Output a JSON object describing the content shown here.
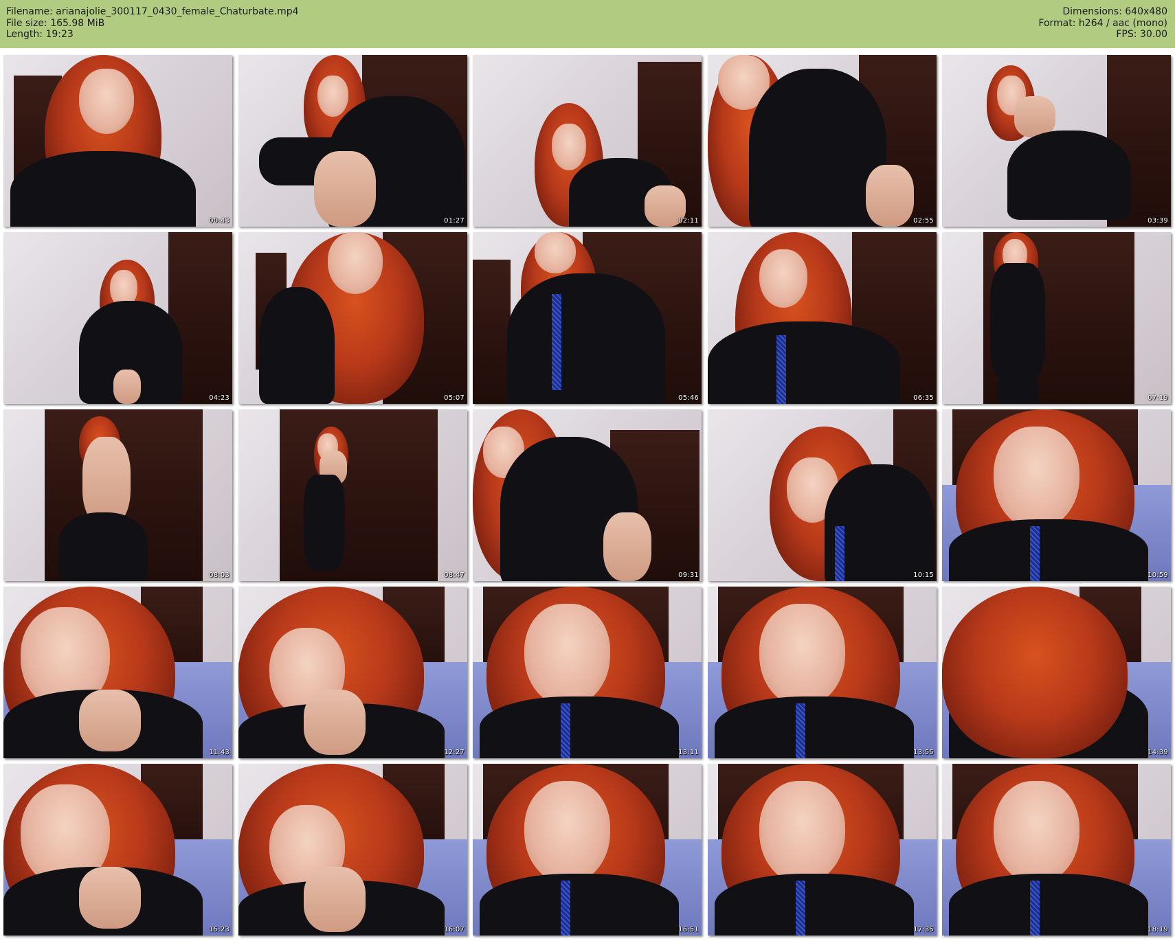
{
  "header": {
    "filename_line": "Filename: arianajolie_300117_0430_female_Chaturbate.mp4",
    "filesize_line": "File size: 165.98 MiB",
    "length_line": "Length: 19:23",
    "dimensions_line": "Dimensions: 640x480",
    "format_line": "Format: h264 / aac (mono)",
    "fps_line": "FPS: 30.00",
    "background_color": "#b1cc81"
  },
  "thumbnails": [
    {
      "timestamp": "00:43",
      "scene": "door-closeup"
    },
    {
      "timestamp": "01:27",
      "scene": "door-legs"
    },
    {
      "timestamp": "02:11",
      "scene": "wall-side"
    },
    {
      "timestamp": "02:55",
      "scene": "sunglasses-close"
    },
    {
      "timestamp": "03:39",
      "scene": "sunglasses-far"
    },
    {
      "timestamp": "04:23",
      "scene": "corner-standing"
    },
    {
      "timestamp": "05:07",
      "scene": "hair-close"
    },
    {
      "timestamp": "05:46",
      "scene": "jacket-tie"
    },
    {
      "timestamp": "06:35",
      "scene": "door-close"
    },
    {
      "timestamp": "07:19",
      "scene": "door-far"
    },
    {
      "timestamp": "08:03",
      "scene": "back-door"
    },
    {
      "timestamp": "08:47",
      "scene": "door-standing"
    },
    {
      "timestamp": "09:31",
      "scene": "side-closeup"
    },
    {
      "timestamp": "10:15",
      "scene": "wall-face"
    },
    {
      "timestamp": "10:59",
      "scene": "face-bed"
    },
    {
      "timestamp": "11:43",
      "scene": "face-hand"
    },
    {
      "timestamp": "12:27",
      "scene": "face-hand-low"
    },
    {
      "timestamp": "13:11",
      "scene": "face-bed"
    },
    {
      "timestamp": "13:55",
      "scene": "face-bed"
    },
    {
      "timestamp": "14:39",
      "scene": "hair-top"
    },
    {
      "timestamp": "15:23",
      "scene": "face-hand"
    },
    {
      "timestamp": "16:07",
      "scene": "face-hand-low"
    },
    {
      "timestamp": "16:51",
      "scene": "face-bed"
    },
    {
      "timestamp": "17:35",
      "scene": "face-bed"
    },
    {
      "timestamp": "18:19",
      "scene": "face-bed"
    }
  ]
}
